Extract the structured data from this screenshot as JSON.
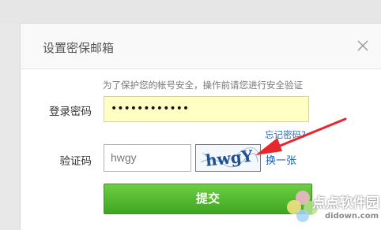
{
  "dialog": {
    "title": "设置密保邮箱",
    "close_icon": "close-icon",
    "security_hint": "为了保护您的帐号安全，操作前请您进行安全验证",
    "password": {
      "label": "登录密码",
      "masked_value": "••••••••••••"
    },
    "forgot_password_link": "忘记密码?",
    "captcha": {
      "label": "验证码",
      "input_value": "hwgy",
      "image_text": "hwgY",
      "refresh_link": "换一张"
    },
    "submit_label": "提交"
  },
  "watermark": {
    "name": "点点软件园",
    "url": "didown.com"
  },
  "colors": {
    "submit_green": "#4cb82c",
    "password_bg": "#ffffc4",
    "link_blue": "#1c5fb5",
    "arrow_red": "#e8262e"
  }
}
